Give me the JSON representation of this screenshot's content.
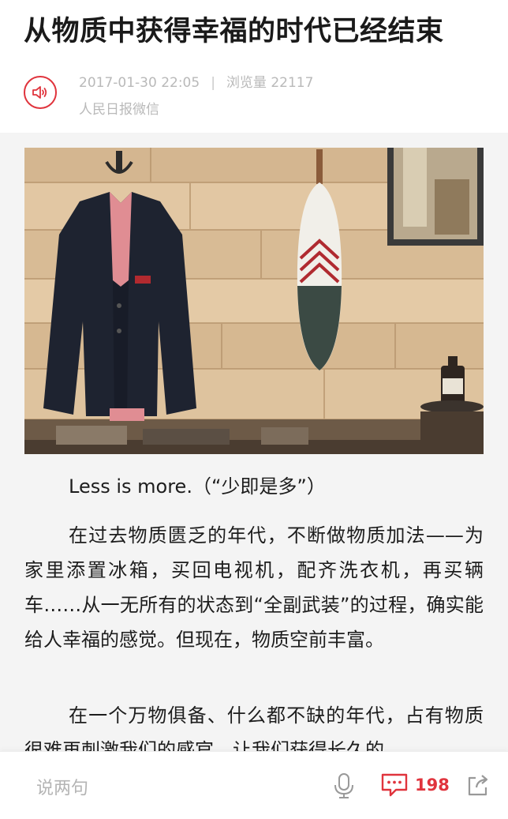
{
  "article": {
    "title": "从物质中获得幸福的时代已经结束",
    "date": "2017-01-30 22:05",
    "separator": "|",
    "views_label": "浏览量",
    "views": "22117",
    "source": "人民日报微信",
    "caption": "Less is more.（“少即是多”）",
    "paragraph1": "在过去物质匮乏的年代，不断做物质加法——为家里添置冰箱，买回电视机，配齐洗衣机，再买辆车……从一无所有的状态到“全副武装”的过程，确实能给人幸福的感觉。但现在，物质空前丰富。",
    "paragraph2": "在一个万物俱备、什么都不缺的年代，占有物质很难再刺激我们的感官，让我们获得长久的"
  },
  "bottom_bar": {
    "comment_placeholder": "说两句",
    "comment_count": "198"
  },
  "icons": {
    "audio": "speaker-icon",
    "mic": "microphone-icon",
    "comment": "comment-bubble-icon",
    "share": "share-icon"
  },
  "colors": {
    "accent": "#e0343d",
    "meta_text": "#b9b9b9",
    "article_background": "#f4f4f4"
  }
}
